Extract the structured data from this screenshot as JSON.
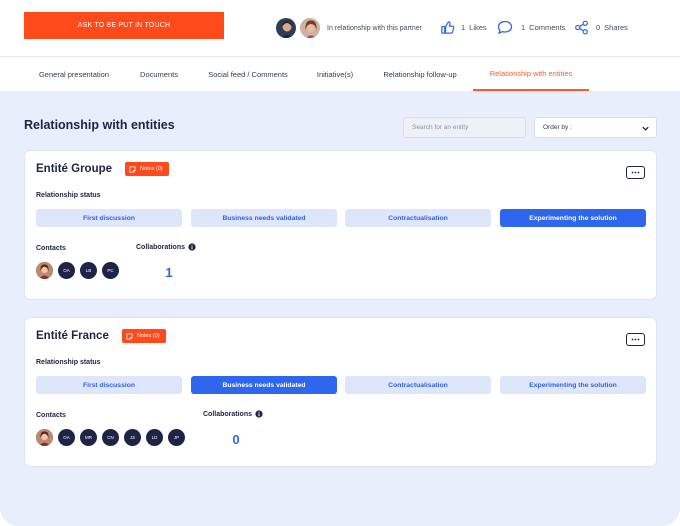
{
  "header": {
    "cta_label": "ASK TO BE PUT IN TOUCH",
    "partners_label": "In relationship with this partner",
    "likes": {
      "count": "1",
      "label": "Likes"
    },
    "comments": {
      "count": "1",
      "label": "Comments"
    },
    "shares": {
      "count": "0",
      "label": "Shares"
    }
  },
  "tabs": [
    {
      "label": "General presentation"
    },
    {
      "label": "Documents"
    },
    {
      "label": "Social feed / Comments"
    },
    {
      "label": "Initiative(s)"
    },
    {
      "label": "Relationship follow-up"
    },
    {
      "label": "Relationship with entities",
      "active": true
    }
  ],
  "main": {
    "title": "Relationship with entities",
    "search_placeholder": "Search for an entity",
    "order_by_label": "Order by :",
    "relationship_status_label": "Relationship status",
    "contacts_label": "Contacts",
    "collaborations_label": "Collaborations",
    "steps": [
      "First discussion",
      "Business needs validated",
      "Contractualisation",
      "Experimenting the solution"
    ],
    "entities": [
      {
        "name": "Entité Groupe",
        "notes_label": "Notes (0)",
        "active_step": 3,
        "contacts": [
          "",
          "OA",
          "LB",
          "PC"
        ],
        "collaborations": "1"
      },
      {
        "name": "Entité France",
        "notes_label": "Notes (0)",
        "active_step": 1,
        "contacts": [
          "",
          "OA",
          "MR",
          "CN",
          "JS",
          "LD",
          "JP"
        ],
        "collaborations": "0"
      }
    ]
  },
  "colors": {
    "accent": "#ff4a1c",
    "primary": "#2f66ee",
    "navy": "#1f2347",
    "background": "#e8eefc"
  },
  "icons": [
    "thumbs-up-icon",
    "comment-icon",
    "share-icon",
    "chevron-down-icon",
    "ellipsis-icon",
    "info-icon",
    "note-icon"
  ]
}
